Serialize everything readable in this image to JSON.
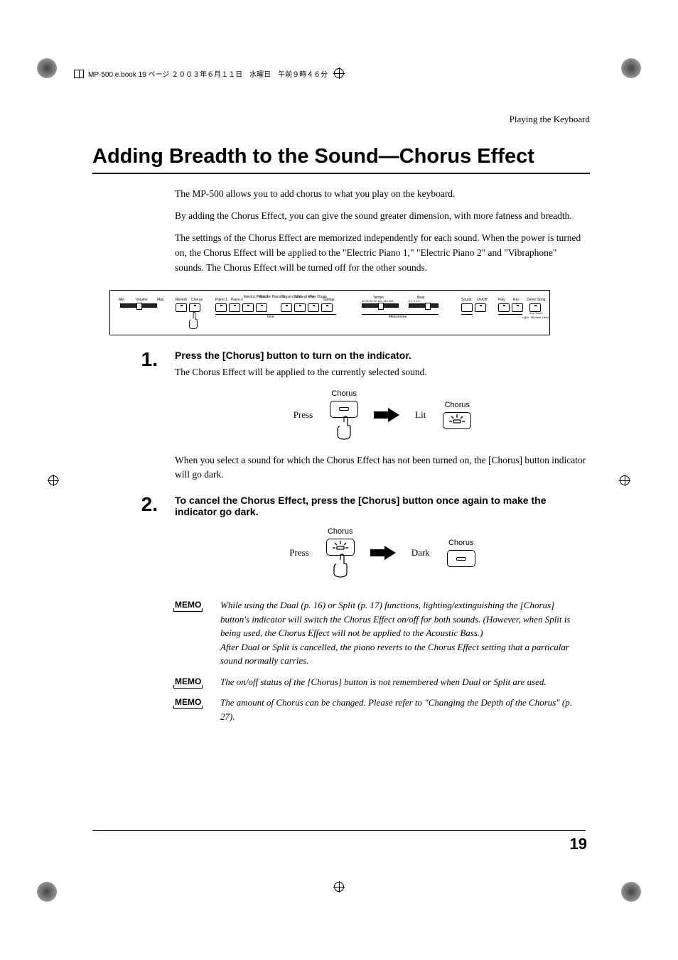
{
  "header_strip": "MP-500.e.book  19 ページ  ２００３年６月１１日　水曜日　午前９時４６分",
  "running_head": "Playing the Keyboard",
  "main_title": "Adding Breadth to the Sound—Chorus Effect",
  "intro": {
    "p1": "The MP-500 allows you to add chorus to what you play on the keyboard.",
    "p2": "By adding the Chorus Effect, you can give the sound greater dimension, with more fatness and breadth.",
    "p3": "The settings of the Chorus Effect are memorized independently for each sound. When the power is turned on, the Chorus Effect will be applied to the \"Electric Piano 1,\" \"Electric Piano 2\" and \"Vibraphone\" sounds. The Chorus Effect will be turned off for the other sounds."
  },
  "panel": {
    "labels": {
      "volume_min": "Min",
      "volume": "Volume",
      "volume_max": "Max",
      "reverb": "Reverb",
      "chorus": "Chorus",
      "piano1": "Piano 1",
      "piano2": "Piano 2",
      "ep1": "Electric Piano 1",
      "ep2": "Electric Piano 2",
      "harpsi": "Harpsi-chord",
      "vibra": "Vibra-phone",
      "pipe": "Pipe Organ",
      "strings": "Strings",
      "tone": "Tone",
      "tempo": "Tempo",
      "tempo_vals": "40 60 80 92 104 144 208",
      "beat": "Beat",
      "beat_vals": "0   2   3   4   6",
      "metronome": "Metronome",
      "sound": "Sound",
      "onoff": "On/Off",
      "play": "Play",
      "rec": "Rec",
      "demosong": "Demo Song",
      "keytouch": "Key Touch",
      "light": "Light",
      "medium": "Medium",
      "heavy": "Heavy"
    }
  },
  "steps": {
    "s1": {
      "num": "1.",
      "head": "Press the [Chorus] button to turn on the indicator.",
      "text1": "The Chorus Effect will be applied to the currently selected sound.",
      "text2": "When you select a sound for which the Chorus Effect has not been turned on, the [Chorus] button indicator will go dark.",
      "diag": {
        "press": "Press",
        "chorus": "Chorus",
        "lit": "Lit"
      }
    },
    "s2": {
      "num": "2.",
      "head": "To cancel the Chorus Effect, press the [Chorus] button once again to make the indicator go dark.",
      "diag": {
        "press": "Press",
        "chorus": "Chorus",
        "dark": "Dark"
      }
    }
  },
  "memos": {
    "label": "MEMO",
    "m1a": "While using the Dual (p. 16) or Split (p. 17) functions, lighting/extinguishing the [Chorus] button's indicator will switch the Chorus Effect on/off for both sounds. (However, when Split is being used, the Chorus Effect will not be applied to the Acoustic Bass.)",
    "m1b": "After Dual or Split is cancelled, the piano reverts to the Chorus Effect setting that a particular sound normally carries.",
    "m2": "The on/off status of the [Chorus] button is not remembered when Dual or Split are used.",
    "m3": "The amount of Chorus can be changed. Please refer to \"Changing the Depth of the Chorus\" (p. 27)."
  },
  "page_number": "19"
}
